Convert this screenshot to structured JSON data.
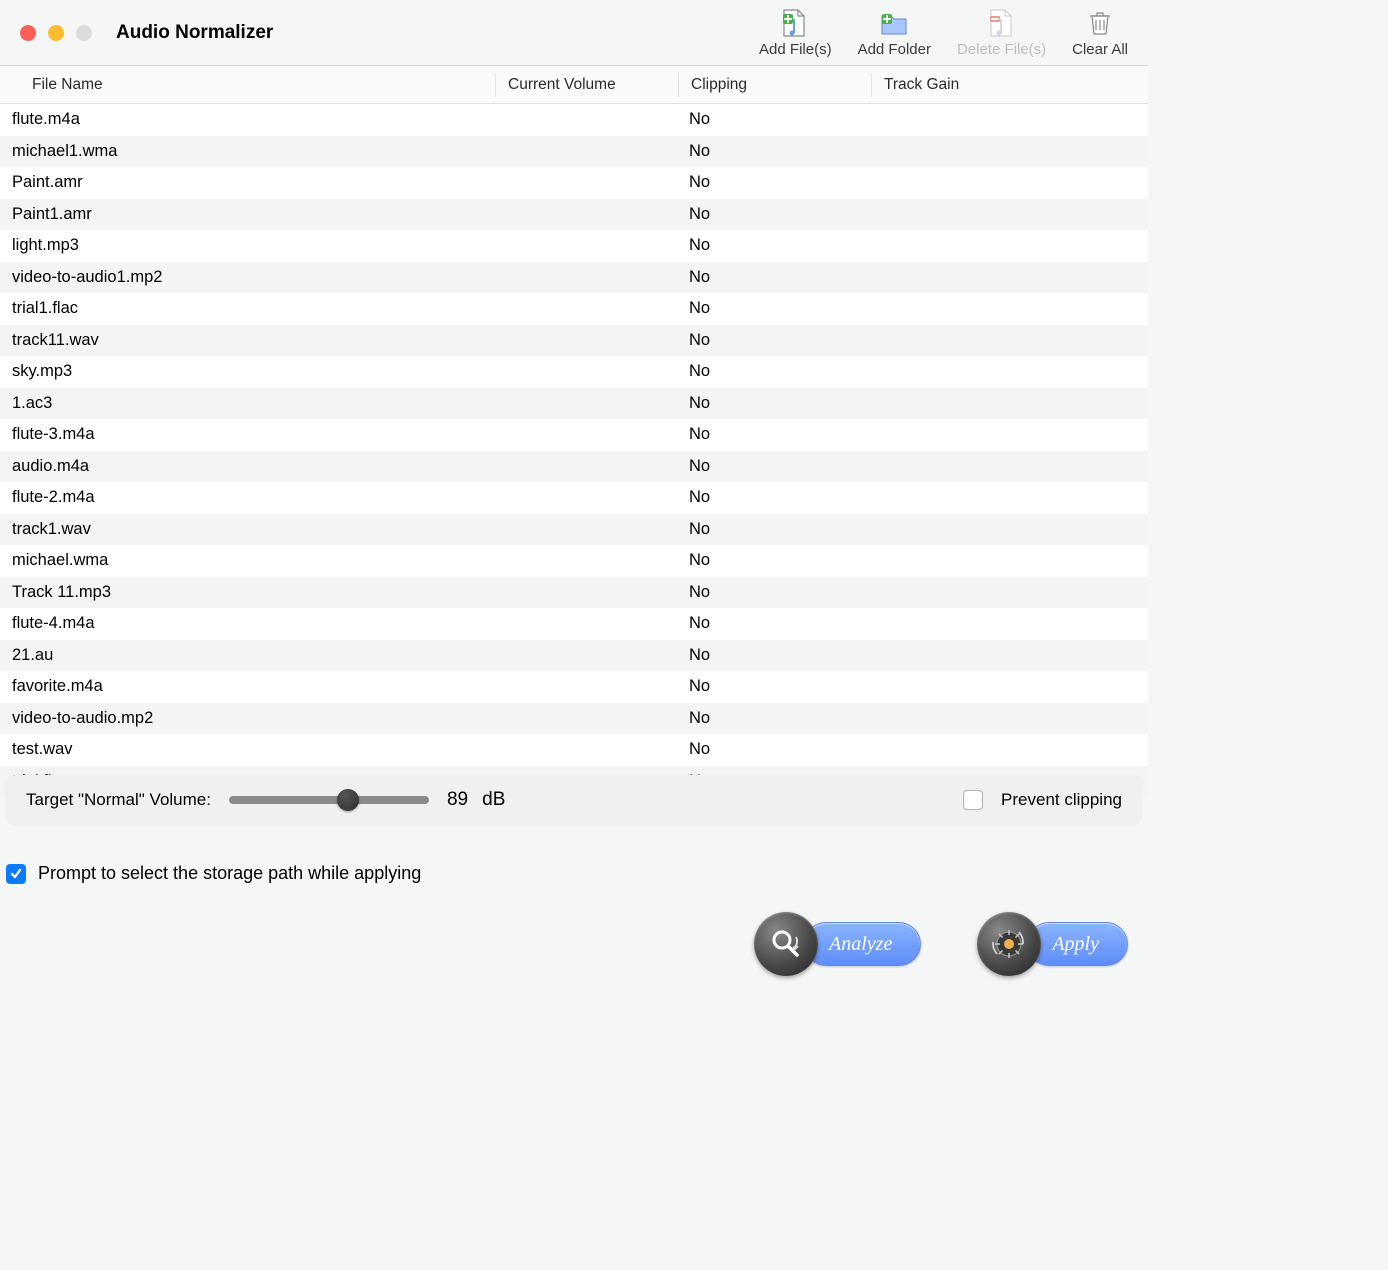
{
  "header": {
    "app_title": "Audio Normalizer",
    "toolbar": {
      "add_files": "Add File(s)",
      "add_folder": "Add Folder",
      "delete_files": "Delete File(s)",
      "clear_all": "Clear All"
    }
  },
  "table": {
    "columns": {
      "filename": "File Name",
      "current_volume": "Current Volume",
      "clipping": "Clipping",
      "track_gain": "Track Gain"
    },
    "rows": [
      {
        "filename": "flute.m4a",
        "current_volume": "",
        "clipping": "No",
        "track_gain": ""
      },
      {
        "filename": "michael1.wma",
        "current_volume": "",
        "clipping": "No",
        "track_gain": ""
      },
      {
        "filename": "Paint.amr",
        "current_volume": "",
        "clipping": "No",
        "track_gain": ""
      },
      {
        "filename": "Paint1.amr",
        "current_volume": "",
        "clipping": "No",
        "track_gain": ""
      },
      {
        "filename": "light.mp3",
        "current_volume": "",
        "clipping": "No",
        "track_gain": ""
      },
      {
        "filename": "video-to-audio1.mp2",
        "current_volume": "",
        "clipping": "No",
        "track_gain": ""
      },
      {
        "filename": "trial1.flac",
        "current_volume": "",
        "clipping": "No",
        "track_gain": ""
      },
      {
        "filename": "track11.wav",
        "current_volume": "",
        "clipping": "No",
        "track_gain": ""
      },
      {
        "filename": "sky.mp3",
        "current_volume": "",
        "clipping": "No",
        "track_gain": ""
      },
      {
        "filename": "1.ac3",
        "current_volume": "",
        "clipping": "No",
        "track_gain": ""
      },
      {
        "filename": "flute-3.m4a",
        "current_volume": "",
        "clipping": "No",
        "track_gain": ""
      },
      {
        "filename": "audio.m4a",
        "current_volume": "",
        "clipping": "No",
        "track_gain": ""
      },
      {
        "filename": "flute-2.m4a",
        "current_volume": "",
        "clipping": "No",
        "track_gain": ""
      },
      {
        "filename": "track1.wav",
        "current_volume": "",
        "clipping": "No",
        "track_gain": ""
      },
      {
        "filename": "michael.wma",
        "current_volume": "",
        "clipping": "No",
        "track_gain": ""
      },
      {
        "filename": "Track 11.mp3",
        "current_volume": "",
        "clipping": "No",
        "track_gain": ""
      },
      {
        "filename": "flute-4.m4a",
        "current_volume": "",
        "clipping": "No",
        "track_gain": ""
      },
      {
        "filename": "21.au",
        "current_volume": "",
        "clipping": "No",
        "track_gain": ""
      },
      {
        "filename": "favorite.m4a",
        "current_volume": "",
        "clipping": "No",
        "track_gain": ""
      },
      {
        "filename": "video-to-audio.mp2",
        "current_volume": "",
        "clipping": "No",
        "track_gain": ""
      },
      {
        "filename": "test.wav",
        "current_volume": "",
        "clipping": "No",
        "track_gain": ""
      },
      {
        "filename": "trial.flac",
        "current_volume": "",
        "clipping": "No",
        "track_gain": ""
      }
    ]
  },
  "controls": {
    "target_label": "Target \"Normal\" Volume:",
    "target_value": "89",
    "target_unit": "dB",
    "prevent_clipping_label": "Prevent clipping",
    "prevent_clipping_checked": false
  },
  "prompt": {
    "label": "Prompt to select the storage path while applying",
    "checked": true
  },
  "actions": {
    "analyze": "Analyze",
    "apply": "Apply"
  }
}
